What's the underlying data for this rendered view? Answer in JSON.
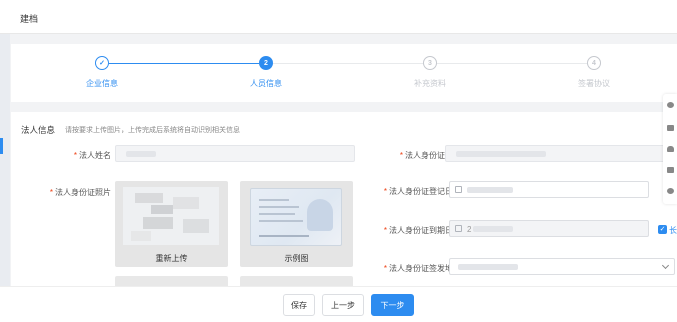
{
  "header": {
    "title": "建档"
  },
  "steps": [
    {
      "label": "企业信息",
      "index": "✓",
      "status": "done"
    },
    {
      "label": "人员信息",
      "index": "2",
      "status": "active"
    },
    {
      "label": "补充资料",
      "index": "3",
      "status": "wait"
    },
    {
      "label": "签署协议",
      "index": "4",
      "status": "wait"
    }
  ],
  "section": {
    "title": "法人信息",
    "hint": "请按要求上传图片，上传完成后系统将自动识别相关信息"
  },
  "fields": {
    "legal_name": {
      "label": "法人姓名",
      "required": "*"
    },
    "legal_id_no": {
      "label": "法人身份证号",
      "required": "*"
    },
    "id_photo": {
      "label": "法人身份证照片",
      "required": "*"
    },
    "id_reg_date": {
      "label": "法人身份证登记日",
      "required": "*"
    },
    "id_expire_date": {
      "label": "法人身份证到期日",
      "required": "*",
      "expire_prefix": "2"
    },
    "id_issue_place": {
      "label": "法人身份证签发地",
      "required": "*"
    }
  },
  "photos": {
    "reupload_label": "重新上传",
    "sample_label": "示例图"
  },
  "checkbox": {
    "label": "长",
    "checked": true
  },
  "buttons": {
    "save": "保存",
    "prev": "上一步",
    "next": "下一步"
  },
  "colors": {
    "primary": "#2d8cf0",
    "wait": "#c5c8ce",
    "required": "#ed4014"
  },
  "icons": [
    "wechat-icon",
    "chat-icon",
    "headset-icon",
    "contact-card-icon",
    "plus-circle-icon"
  ]
}
